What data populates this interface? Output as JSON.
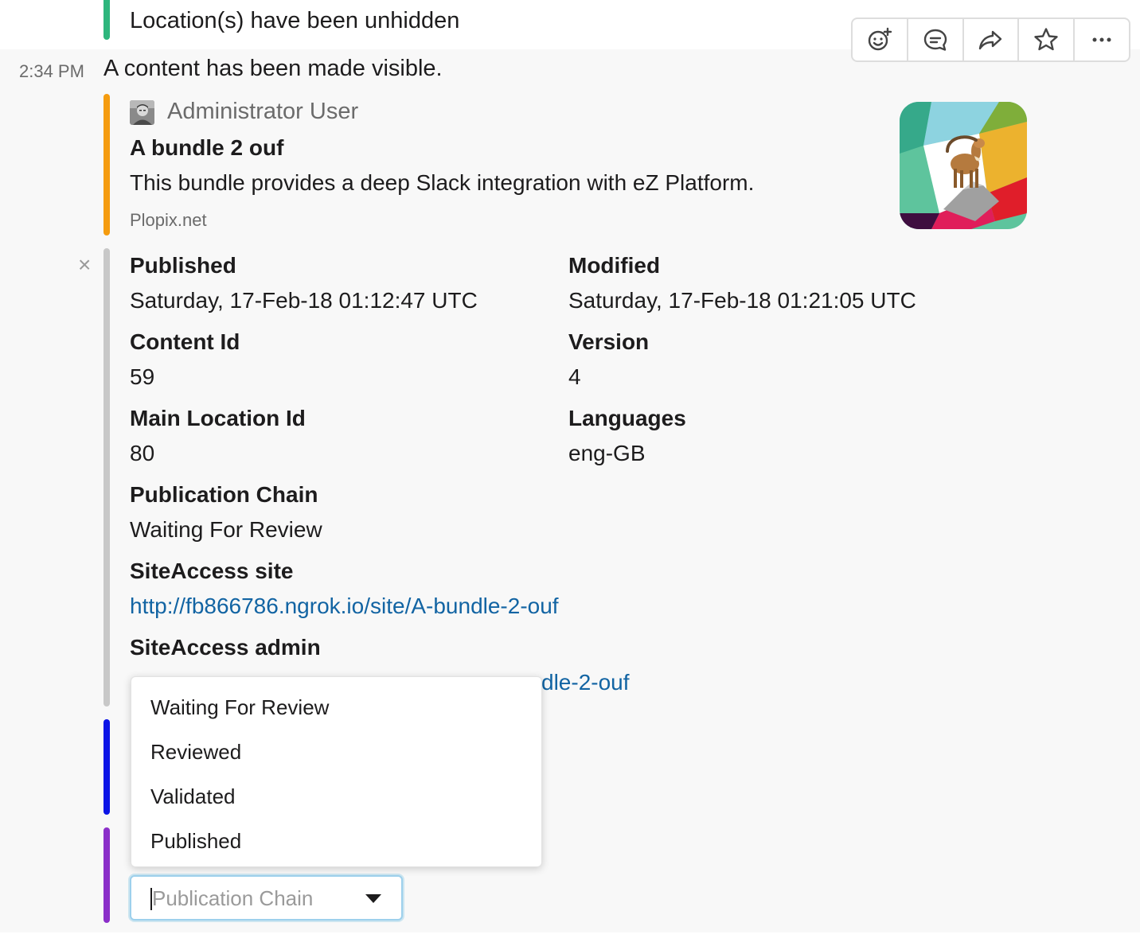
{
  "top": {
    "text": "Location(s) have been unhidden"
  },
  "message": {
    "timestamp": "2:34 PM",
    "title": "A content has been made visible."
  },
  "toolbar": [
    {
      "icon": "add-reaction-icon"
    },
    {
      "icon": "start-thread-icon"
    },
    {
      "icon": "share-message-icon"
    },
    {
      "icon": "star-icon"
    },
    {
      "icon": "more-actions-icon"
    }
  ],
  "attachment": {
    "author": "Administrator User",
    "title": "A bundle 2 ouf",
    "text": "This bundle provides a deep Slack integration with eZ Platform.",
    "footer": "Plopix.net"
  },
  "fields": {
    "published_label": "Published",
    "published_value": "Saturday, 17-Feb-18 01:12:47 UTC",
    "modified_label": "Modified",
    "modified_value": "Saturday, 17-Feb-18 01:21:05 UTC",
    "content_id_label": "Content Id",
    "content_id_value": "59",
    "version_label": "Version",
    "version_value": "4",
    "main_location_label": "Main Location Id",
    "main_location_value": "80",
    "languages_label": "Languages",
    "languages_value": "eng-GB",
    "publication_chain_label": "Publication Chain",
    "publication_chain_value": "Waiting For Review",
    "siteaccess_site_label": "SiteAccess site",
    "siteaccess_site_value": "http://fb866786.ngrok.io/site/A-bundle-2-ouf",
    "siteaccess_admin_label": "SiteAccess admin",
    "siteaccess_admin_value_visible": "dle-2-ouf"
  },
  "dropdown": {
    "options": [
      "Waiting For Review",
      "Reviewed",
      "Validated",
      "Published"
    ],
    "placeholder": "Publication Chain"
  },
  "colors": {
    "top_accent": "#2eb67d",
    "attachment_accent": "#f59c0f",
    "fields_accent": "#c8c8c8",
    "blue_accent": "#0b14e6",
    "purple_accent": "#8b2fc9",
    "link": "#1264a3"
  }
}
